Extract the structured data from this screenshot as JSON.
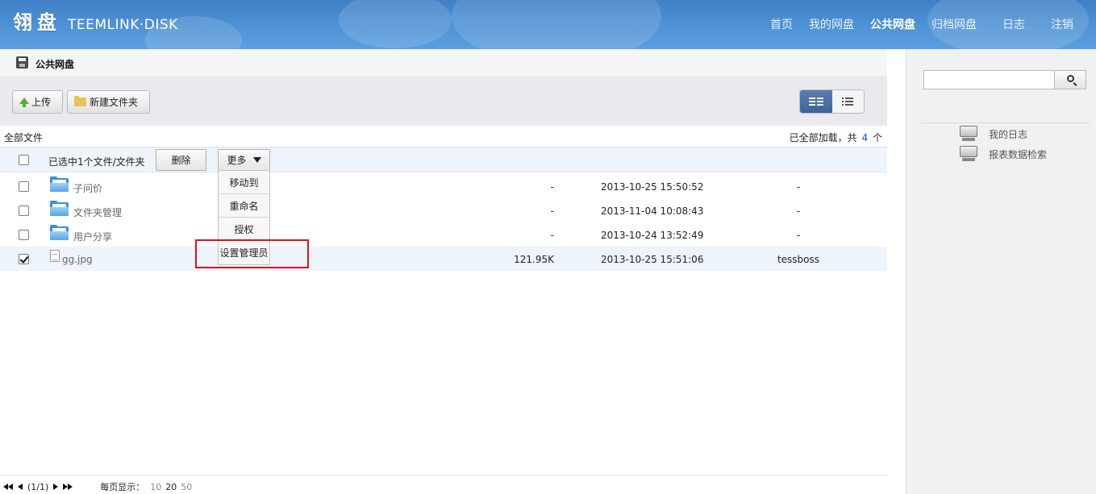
{
  "brand": {
    "logo_cn": "翎盘",
    "logo_en": "TEEMLINK·DISK"
  },
  "nav": [
    {
      "label": "首页",
      "active": false
    },
    {
      "label": "我的网盘",
      "active": false
    },
    {
      "label": "公共网盘",
      "active": true
    },
    {
      "label": "归档网盘",
      "active": false
    },
    {
      "label": "日志",
      "active": false
    },
    {
      "label": "注销",
      "active": false
    }
  ],
  "breadcrumb": {
    "title": "公共网盘"
  },
  "toolbar": {
    "upload_label": "上传",
    "new_folder_label": "新建文件夹",
    "view_mode": "grid"
  },
  "file_list": {
    "root_label": "全部文件",
    "load_status_prefix": "已全部加载，共",
    "total_count": "4",
    "load_status_suffix": "个"
  },
  "selection_bar": {
    "text": "已选中1个文件/文件夹",
    "delete_label": "删除",
    "more_label": "更多"
  },
  "more_menu": {
    "items": [
      "移动到",
      "重命名",
      "授权",
      "设置管理员"
    ],
    "highlighted": "设置管理员"
  },
  "files": [
    {
      "name": "子问价",
      "type": "folder",
      "size": "-",
      "date": "2013-10-25 15:50:52",
      "owner": "-",
      "checked": false
    },
    {
      "name": "文件夹管理",
      "type": "folder",
      "size": "-",
      "date": "2013-11-04 10:08:43",
      "owner": "-",
      "checked": false
    },
    {
      "name": "用户分享",
      "type": "folder",
      "size": "-",
      "date": "2013-10-24 13:52:49",
      "owner": "-",
      "checked": false
    },
    {
      "name": "gg.jpg",
      "type": "file",
      "size": "121.95K",
      "date": "2013-10-25 15:51:06",
      "owner": "tessboss",
      "checked": true
    }
  ],
  "pager": {
    "info": "(1/1)",
    "per_page_label": "每页显示：",
    "options": [
      "10",
      "20",
      "50"
    ],
    "selected": "20"
  },
  "sidebar": {
    "search_value": "",
    "links": [
      "我的日志",
      "报表数据检索"
    ]
  },
  "colors": {
    "header": "#4a8cd2",
    "accent_blue": "#1a4fc4",
    "highlight_red": "#d5141b"
  }
}
